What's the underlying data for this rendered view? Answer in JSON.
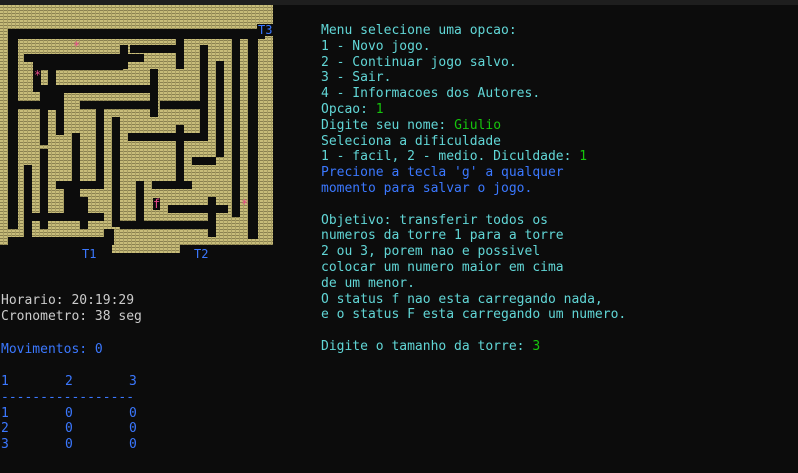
{
  "maze": {
    "labels": {
      "t1": "T1",
      "t2": "T2",
      "t3": "T3"
    },
    "player_marker": "f",
    "number_markers": [
      "*",
      "*",
      "*"
    ],
    "colors": {
      "wall": "#c8bd7a",
      "background": "#0c0c0c",
      "label": "#3b78ff",
      "marker": "#e84a8a"
    }
  },
  "status": {
    "horario": "Horario: 20:19:29",
    "cronometro": "Cronometro: 38 seg",
    "movimentos": "Movimentos: 0"
  },
  "table": {
    "headers": [
      "1",
      "2",
      "3"
    ],
    "separator": "-----------------",
    "rows": [
      [
        "1",
        "0",
        "0"
      ],
      [
        "2",
        "0",
        "0"
      ],
      [
        "3",
        "0",
        "0"
      ]
    ]
  },
  "menu": {
    "title": "Menu selecione uma opcao:",
    "options": [
      "1 - Novo jogo.",
      "2 - Continuar jogo salvo.",
      "3 - Sair.",
      "4 - Informacoes dos Autores."
    ],
    "opcao_label": "Opcao: ",
    "opcao_value": "1",
    "nome_label": "Digite seu nome: ",
    "nome_value": "Giulio",
    "dificuldade_title": "Seleciona a dificuldade",
    "dificuldade_label": "1 - facil, 2 - medio. Diculdade: ",
    "dificuldade_value": "1",
    "save_hint": [
      "Precione a tecla 'g' a qualquer",
      "momento para salvar o jogo."
    ],
    "objetivo": [
      "Objetivo: transferir todos os",
      "numeros da torre 1 para a torre",
      "2 ou 3, porem nao e possivel",
      "colocar um numero maior em cima",
      "de um menor.",
      "O status f nao esta carregando nada,",
      "e o status F esta carregando um numero."
    ],
    "tamanho_label": "Digite o tamanho da torre: ",
    "tamanho_value": "3"
  },
  "colors": {
    "text": "#cccccc",
    "cyan": "#61d6d6",
    "blue": "#3b78ff",
    "green": "#16c60c"
  }
}
